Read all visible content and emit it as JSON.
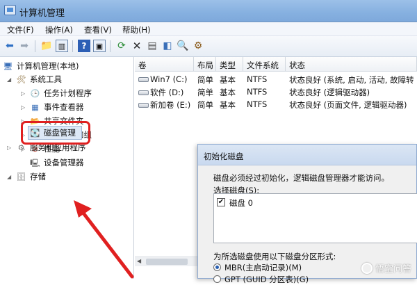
{
  "window": {
    "title": "计算机管理",
    "icon": "computer-management-icon"
  },
  "menu": {
    "file": "文件(F)",
    "action": "操作(A)",
    "view": "查看(V)",
    "help": "帮助(H)"
  },
  "toolbar": {
    "icons": [
      "back-icon",
      "forward-icon",
      "up-icon",
      "show-hide-tree-icon",
      "help-icon",
      "console-icon",
      "refresh-icon",
      "delete-icon",
      "properties-icon",
      "export-icon",
      "search-icon",
      "settings-icon"
    ]
  },
  "tree": {
    "root": "计算机管理(本地)",
    "system_tools": "系统工具",
    "task_scheduler": "任务计划程序",
    "event_viewer": "事件查看器",
    "shared_folders": "共享文件夹",
    "local_users": "本地用户和组",
    "performance": "性能",
    "device_manager": "设备管理器",
    "storage": "存储",
    "disk_management": "磁盘管理",
    "services": "服务和应用程序"
  },
  "volumes": {
    "columns": [
      "卷",
      "布局",
      "类型",
      "文件系统",
      "状态"
    ],
    "rows": [
      [
        "Win7 (C:)",
        "简单",
        "基本",
        "NTFS",
        "状态良好 (系统, 启动, 活动, 故障转"
      ],
      [
        "软件 (D:)",
        "简单",
        "基本",
        "NTFS",
        "状态良好 (逻辑驱动器)"
      ],
      [
        "新加卷 (E:)",
        "简单",
        "基本",
        "NTFS",
        "状态良好 (页面文件, 逻辑驱动器)"
      ]
    ]
  },
  "dialog": {
    "title": "初始化磁盘",
    "message": "磁盘必须经过初始化，逻辑磁盘管理器才能访问。",
    "select_label": "选择磁盘(S):",
    "disk_item": "磁盘 0",
    "disk_checked": true,
    "partition_label": "为所选磁盘使用以下磁盘分区形式:",
    "mbr_option": "MBR(主启动记录)(M)",
    "gpt_option": "GPT (GUID 分区表)(G)",
    "selected_option": "MBR"
  },
  "watermark": "悟空问答",
  "colors": {
    "highlight": "#e02020",
    "titlebar": "#86b0e0",
    "selection": "#dde8f6"
  }
}
